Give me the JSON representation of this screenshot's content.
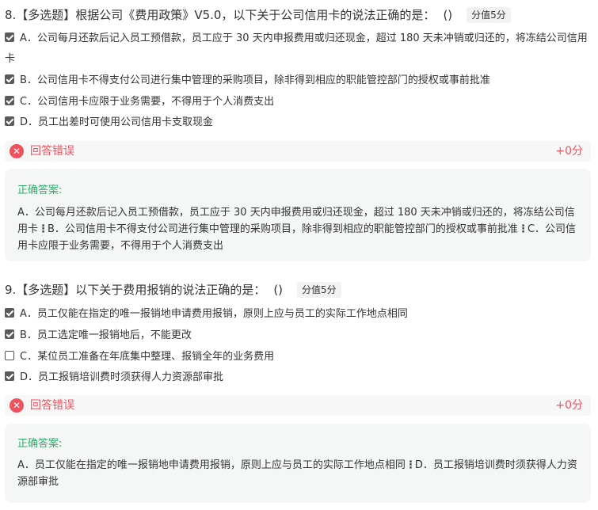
{
  "questions": [
    {
      "title": "8.【多选题】根据公司《费用政策》V5.0，以下关于公司信用卡的说法正确的是：",
      "paren": "()",
      "score_tag": "分值5分",
      "options": [
        {
          "text": "A．公司每月还款后记入员工预借款，员工应于 30 天内申报费用或归还现金，超过 180 天未冲销或归还的，将冻结公司信用卡",
          "checked": true
        },
        {
          "text": "B．公司信用卡不得支付公司进行集中管理的采购项目，除非得到相应的职能管控部门的授权或事前批准",
          "checked": true
        },
        {
          "text": "C．公司信用卡应限于业务需要，不得用于个人消费支出",
          "checked": true
        },
        {
          "text": "D．员工出差时可使用公司信用卡支取现金",
          "checked": true
        }
      ],
      "result": {
        "text": "回答错误",
        "score": "+0分"
      },
      "answer": {
        "label": "正确答案:",
        "parts": [
          "A．公司每月还款后记入员工预借款，员工应于 30 天内申报费用或归还现金，超过 180 天未冲销或归还的，将冻结公司信用卡",
          "B．公司信用卡不得支付公司进行集中管理的采购项目，除非得到相应的职能管控部门的授权或事前批准",
          "C．公司信用卡应限于业务需要，不得用于个人消费支出"
        ]
      }
    },
    {
      "title": "9.【多选题】以下关于费用报销的说法正确的是：",
      "paren": "()",
      "score_tag": "分值5分",
      "options": [
        {
          "text": "A．员工仅能在指定的唯一报销地申请费用报销，原则上应与员工的实际工作地点相同",
          "checked": true
        },
        {
          "text": "B．员工选定唯一报销地后，不能更改",
          "checked": true
        },
        {
          "text": "C．某位员工准备在年底集中整理、报销全年的业务费用",
          "checked": false
        },
        {
          "text": "D．员工报销培训费时须获得人力资源部审批",
          "checked": true
        }
      ],
      "result": {
        "text": "回答错误",
        "score": "+0分"
      },
      "answer": {
        "label": "正确答案:",
        "parts": [
          "A．员工仅能在指定的唯一报销地申请费用报销，原则上应与员工的实际工作地点相同",
          "D．员工报销培训费时须获得人力资源部审批"
        ]
      }
    }
  ],
  "icons": {
    "error": "close-circle-icon",
    "checkbox": "checkbox-icon"
  },
  "colors": {
    "error": "#f0525d",
    "correct_label": "#2faa6b",
    "answer_bg": "#f5f7f6"
  },
  "separator": "⋮"
}
